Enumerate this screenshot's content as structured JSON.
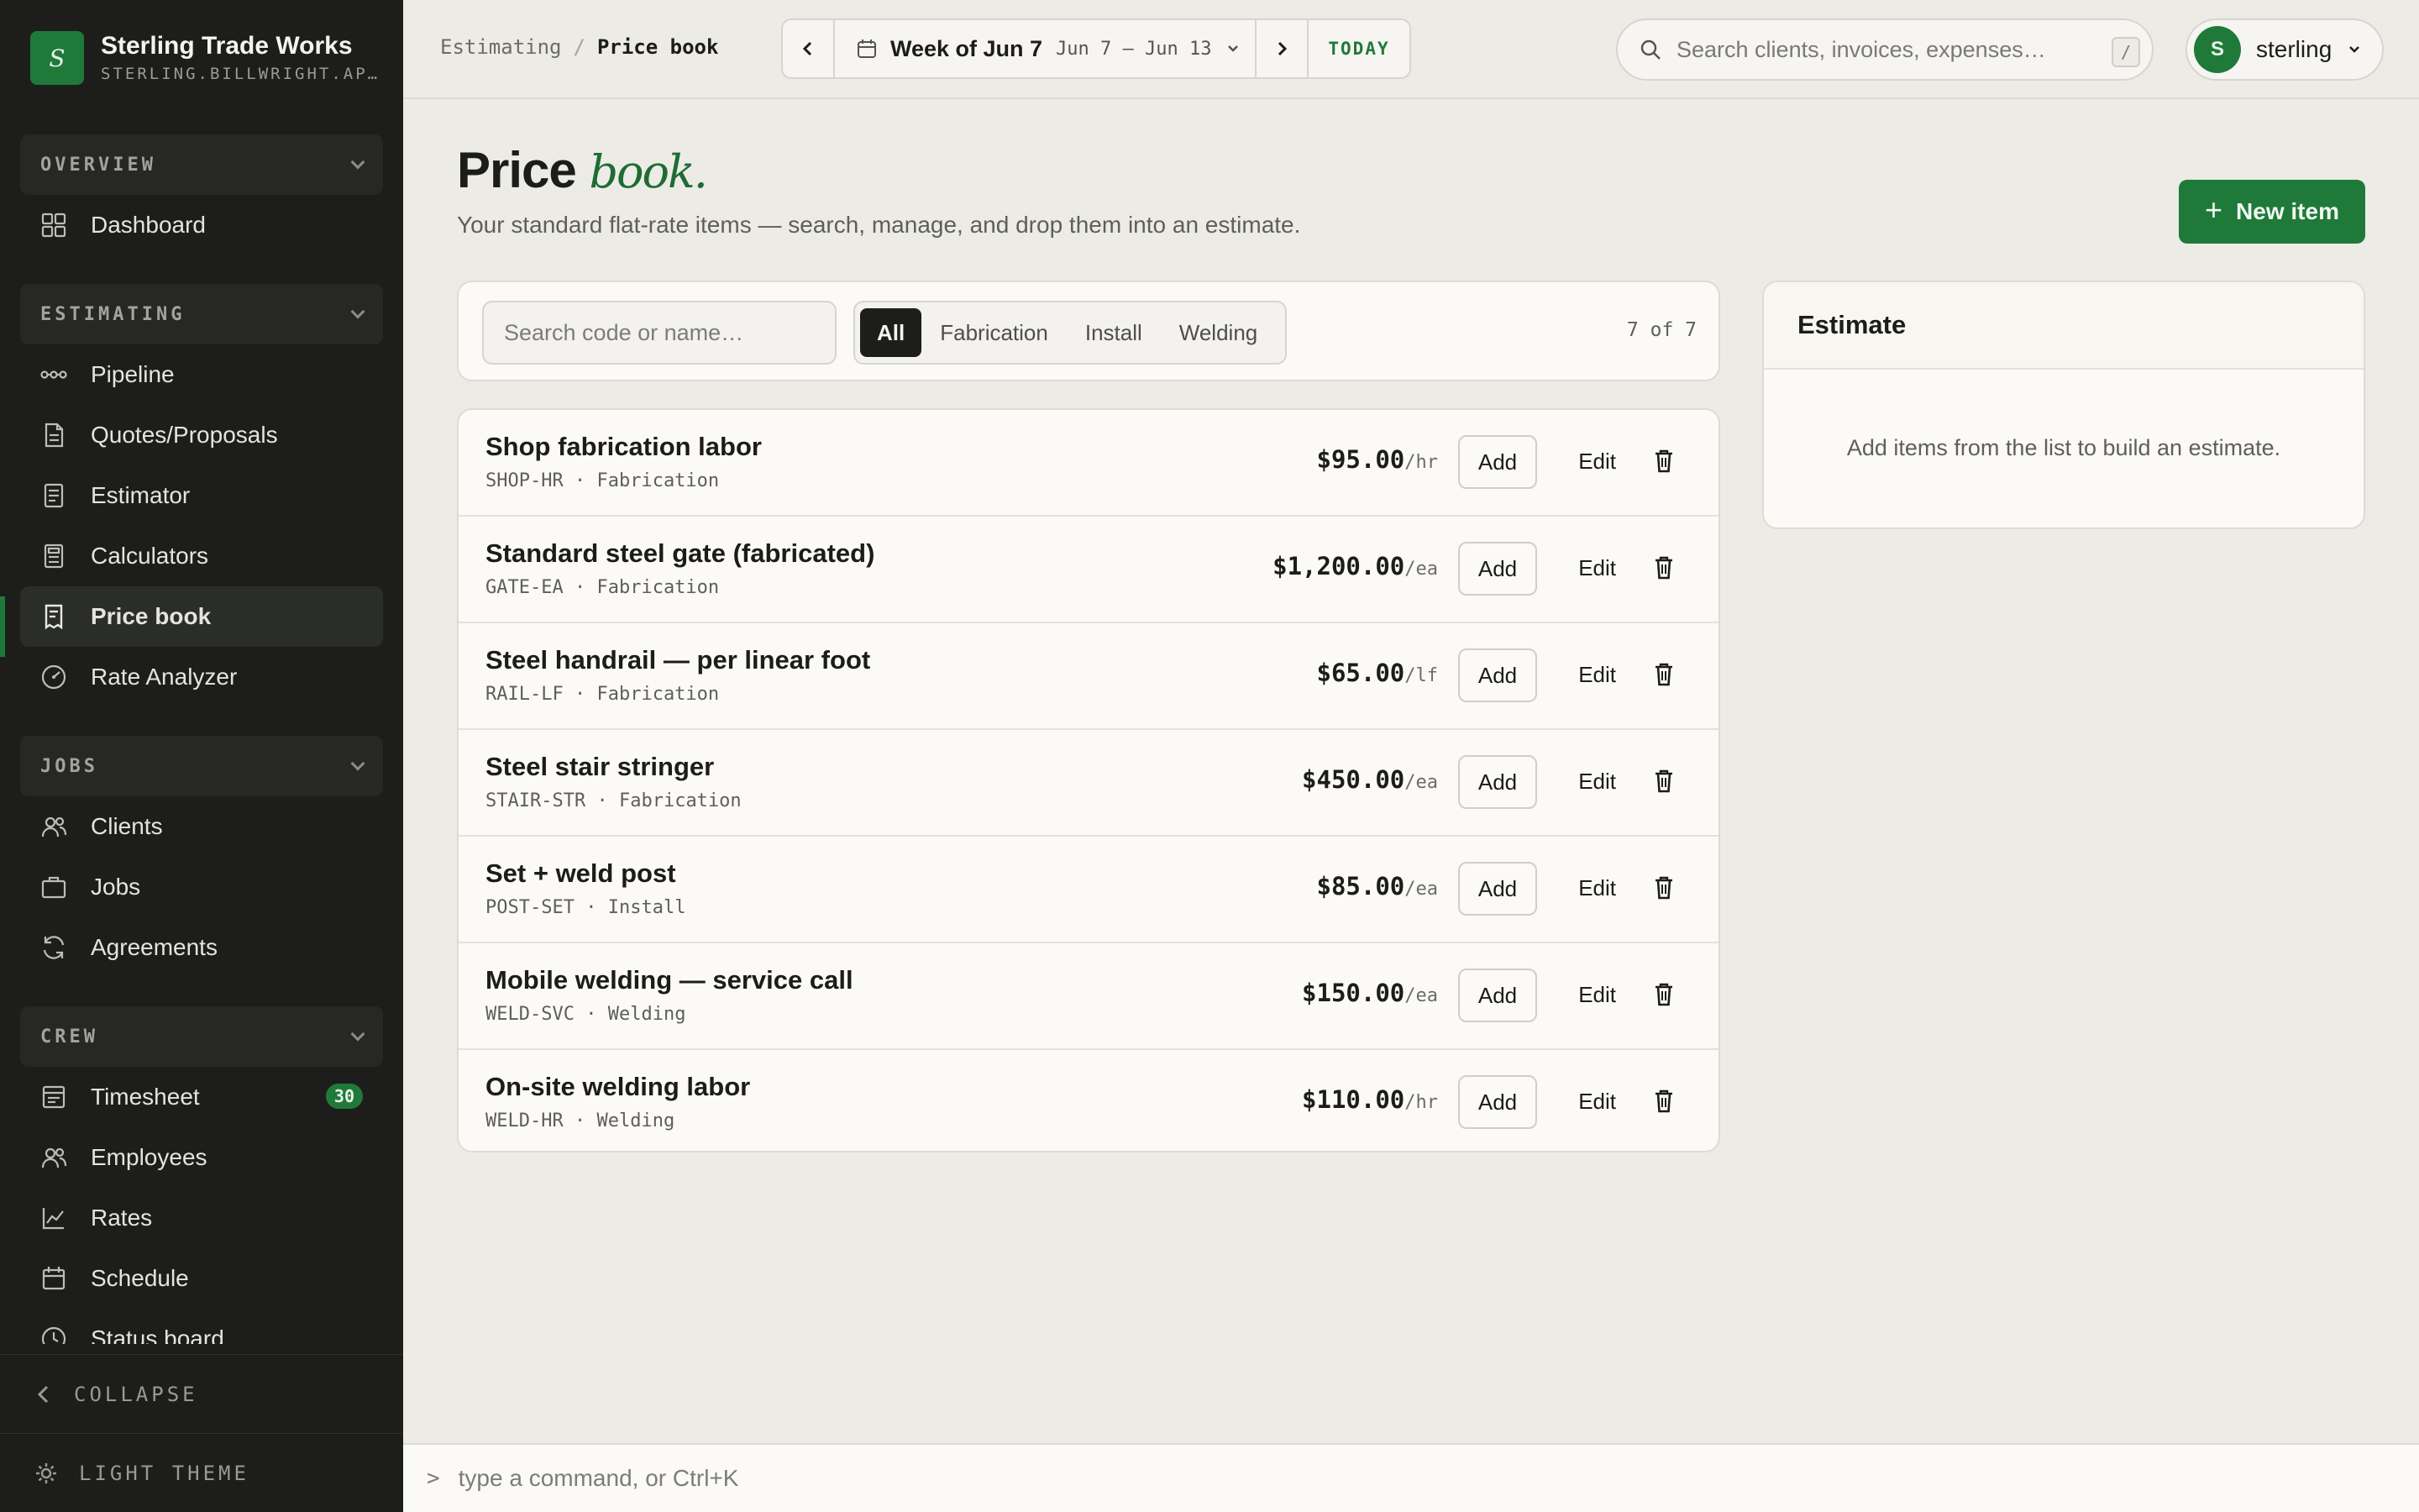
{
  "brand": {
    "initial": "S",
    "name": "Sterling Trade Works",
    "domain": "STERLING.BILLWRIGHT.APP"
  },
  "sidebar": {
    "sections": [
      {
        "label": "OVERVIEW",
        "items": [
          {
            "label": "Dashboard",
            "icon": "grid-icon"
          }
        ]
      },
      {
        "label": "ESTIMATING",
        "items": [
          {
            "label": "Pipeline",
            "icon": "pipeline-icon"
          },
          {
            "label": "Quotes/Proposals",
            "icon": "document-icon"
          },
          {
            "label": "Estimator",
            "icon": "clipboard-icon"
          },
          {
            "label": "Calculators",
            "icon": "calculator-icon"
          },
          {
            "label": "Price book",
            "icon": "receipt-icon",
            "active": true
          },
          {
            "label": "Rate Analyzer",
            "icon": "gauge-icon"
          }
        ]
      },
      {
        "label": "JOBS",
        "items": [
          {
            "label": "Clients",
            "icon": "users-icon"
          },
          {
            "label": "Jobs",
            "icon": "briefcase-icon"
          },
          {
            "label": "Agreements",
            "icon": "refresh-icon"
          }
        ]
      },
      {
        "label": "CREW",
        "items": [
          {
            "label": "Timesheet",
            "icon": "timesheet-icon",
            "badge": "30"
          },
          {
            "label": "Employees",
            "icon": "users-icon"
          },
          {
            "label": "Rates",
            "icon": "chart-line-icon"
          },
          {
            "label": "Schedule",
            "icon": "calendar-icon"
          },
          {
            "label": "Status board",
            "icon": "clock-icon"
          }
        ]
      }
    ],
    "collapse_label": "COLLAPSE",
    "theme_label": "LIGHT THEME"
  },
  "topbar": {
    "breadcrumb": [
      "Estimating",
      "Price book"
    ],
    "week_label": "Week of Jun 7",
    "week_range": "Jun 7 – Jun 13",
    "today_label": "TODAY",
    "search_placeholder": "Search clients, invoices, expenses…",
    "search_shortcut": "/",
    "user": {
      "initial": "S",
      "name": "sterling"
    }
  },
  "main": {
    "title": "Price",
    "title_accent": "book.",
    "subtitle": "Your standard flat-rate items — search, manage, and drop them into an estimate.",
    "new_button": "New item",
    "filter": {
      "search_placeholder": "Search code or name…",
      "tabs": [
        "All",
        "Fabrication",
        "Install",
        "Welding"
      ],
      "selected": "All",
      "count": "7 of 7"
    },
    "row_actions": {
      "add": "Add",
      "edit": "Edit"
    },
    "items": [
      {
        "name": "Shop fabrication labor",
        "code": "SHOP-HR",
        "category": "Fabrication",
        "price": "$95.00",
        "unit": "/hr"
      },
      {
        "name": "Standard steel gate (fabricated)",
        "code": "GATE-EA",
        "category": "Fabrication",
        "price": "$1,200.00",
        "unit": "/ea"
      },
      {
        "name": "Steel handrail — per linear foot",
        "code": "RAIL-LF",
        "category": "Fabrication",
        "price": "$65.00",
        "unit": "/lf"
      },
      {
        "name": "Steel stair stringer",
        "code": "STAIR-STR",
        "category": "Fabrication",
        "price": "$450.00",
        "unit": "/ea"
      },
      {
        "name": "Set + weld post",
        "code": "POST-SET",
        "category": "Install",
        "price": "$85.00",
        "unit": "/ea"
      },
      {
        "name": "Mobile welding — service call",
        "code": "WELD-SVC",
        "category": "Welding",
        "price": "$150.00",
        "unit": "/ea"
      },
      {
        "name": "On-site welding labor",
        "code": "WELD-HR",
        "category": "Welding",
        "price": "$110.00",
        "unit": "/hr"
      }
    ],
    "estimate": {
      "title": "Estimate",
      "empty_text": "Add items from the list to build an estimate."
    }
  },
  "command_bar": {
    "prompt": ">",
    "placeholder": "type a command, or Ctrl+K"
  },
  "colors": {
    "accent": "#1f7a3a",
    "sidebar_bg": "#1d1e1c",
    "page_bg": "#ecebe6"
  }
}
